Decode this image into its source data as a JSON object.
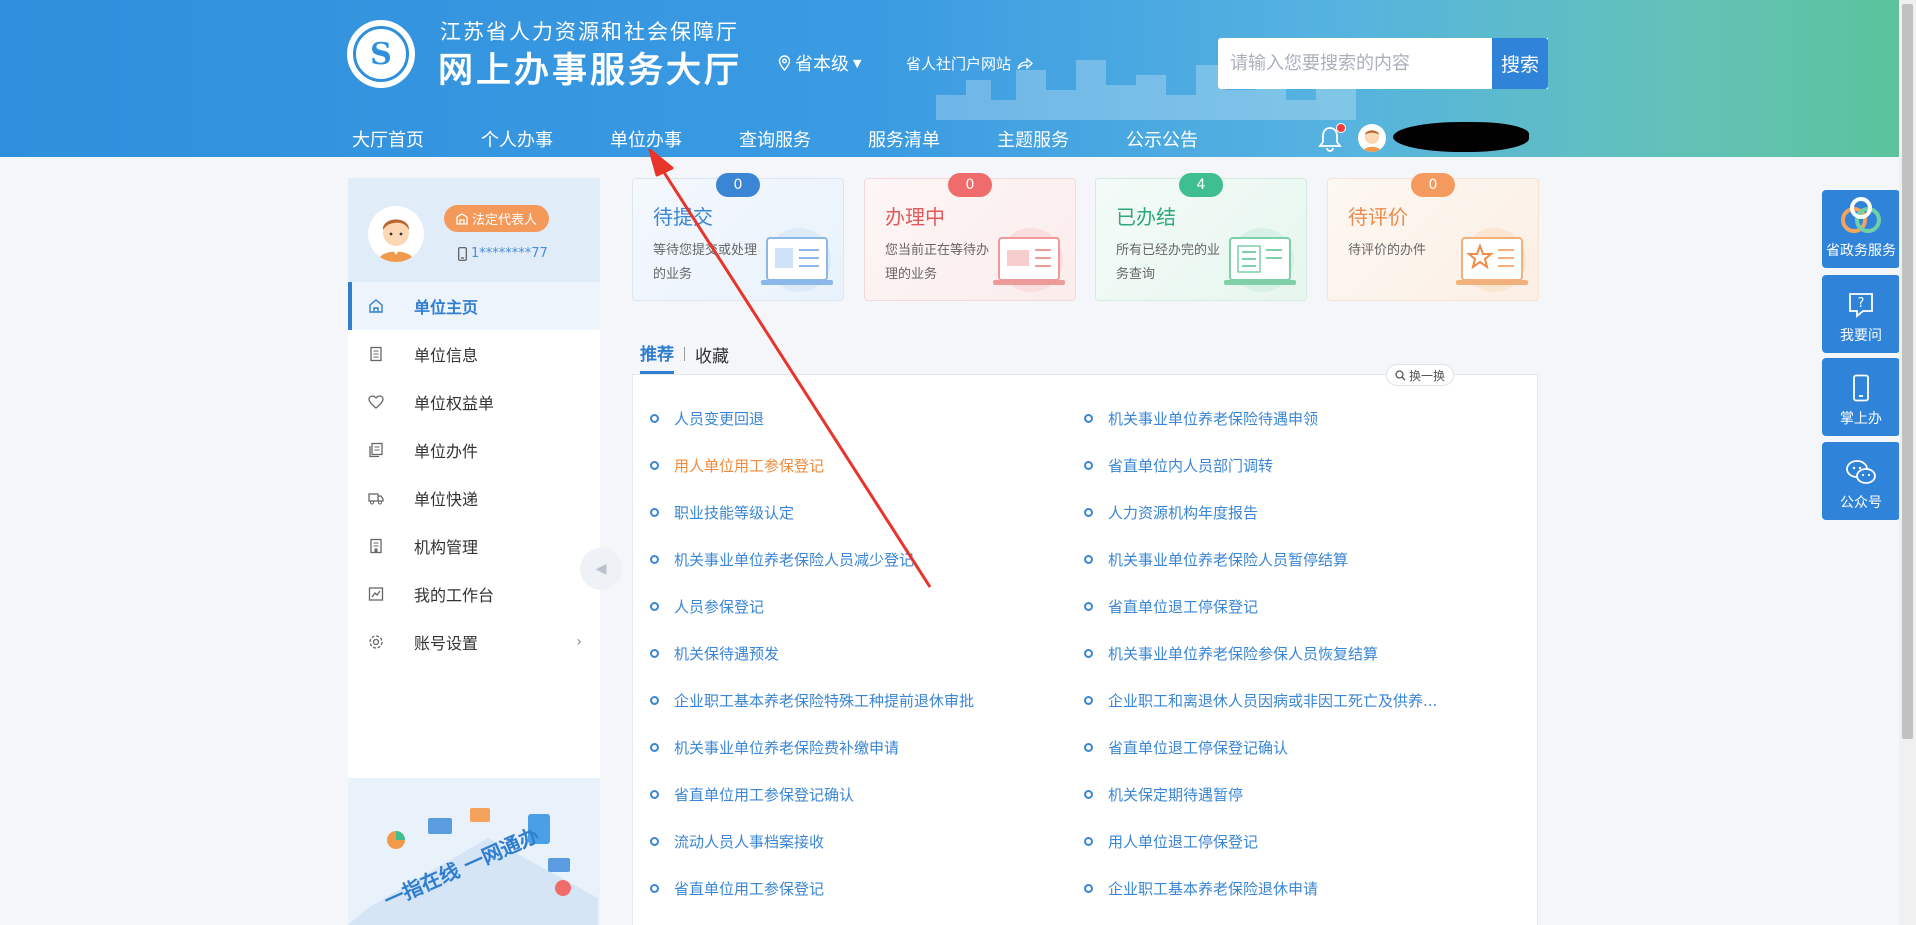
{
  "header": {
    "title_top": "江苏省人力资源和社会保障厅",
    "title_main": "网上办事服务大厅",
    "region": "省本级",
    "portal_link": "省人社门户网站",
    "search_placeholder": "请输入您要搜索的内容",
    "search_button": "搜索",
    "nav": [
      "大厅首页",
      "个人办事",
      "单位办事",
      "查询服务",
      "服务清单",
      "主题服务",
      "公示公告"
    ]
  },
  "profile": {
    "role": "法定代表人",
    "phone": "1********77"
  },
  "sidebar": {
    "items": [
      {
        "label": "单位主页",
        "icon": "home-icon"
      },
      {
        "label": "单位信息",
        "icon": "document-icon"
      },
      {
        "label": "单位权益单",
        "icon": "heart-shield-icon"
      },
      {
        "label": "单位办件",
        "icon": "files-icon"
      },
      {
        "label": "单位快递",
        "icon": "truck-icon"
      },
      {
        "label": "机构管理",
        "icon": "building-icon"
      },
      {
        "label": "我的工作台",
        "icon": "chart-icon"
      },
      {
        "label": "账号设置",
        "icon": "gear-icon"
      }
    ],
    "illustration_text": "一指在线 一网通办"
  },
  "cards": [
    {
      "title": "待提交",
      "desc": "等待您提交或处理的业务",
      "count": "0",
      "color": "#3a86d4",
      "title_color": "#3a86d4"
    },
    {
      "title": "办理中",
      "desc": "您当前正在等待办理的业务",
      "count": "0",
      "color": "#f06b6b",
      "title_color": "#e45a5a"
    },
    {
      "title": "已办结",
      "desc": "所有已经办完的业务查询",
      "count": "4",
      "color": "#3fbf8f",
      "title_color": "#2fa87a"
    },
    {
      "title": "待评价",
      "desc": "待评价的办件",
      "count": "0",
      "color": "#f59a5e",
      "title_color": "#ef8a4a"
    }
  ],
  "tabs": {
    "recommend": "推荐",
    "favorites": "收藏",
    "refresh": "换一换"
  },
  "services": [
    "人员变更回退",
    "机关事业单位养老保险待遇申领",
    "用人单位用工参保登记",
    "省直单位内人员部门调转",
    "职业技能等级认定",
    "人力资源机构年度报告",
    "机关事业单位养老保险人员减少登记",
    "机关事业单位养老保险人员暂停结算",
    "人员参保登记",
    "省直单位退工停保登记",
    "机关保待遇预发",
    "机关事业单位养老保险参保人员恢复结算",
    "企业职工基本养老保险特殊工种提前退休审批",
    "企业职工和离退休人员因病或非因工死亡及供养...",
    "机关事业单位养老保险费补缴申请",
    "省直单位退工停保登记确认",
    "省直单位用工参保登记确认",
    "机关保定期待遇暂停",
    "流动人员人事档案接收",
    "用人单位退工停保登记",
    "省直单位用工参保登记",
    "企业职工基本养老保险退休申请"
  ],
  "float_buttons": [
    "省政务服务",
    "我要问",
    "掌上办",
    "公众号"
  ],
  "colors": {
    "primary": "#2f83d8",
    "highlight": "#f18a3d",
    "annotation": "#e8342a"
  }
}
